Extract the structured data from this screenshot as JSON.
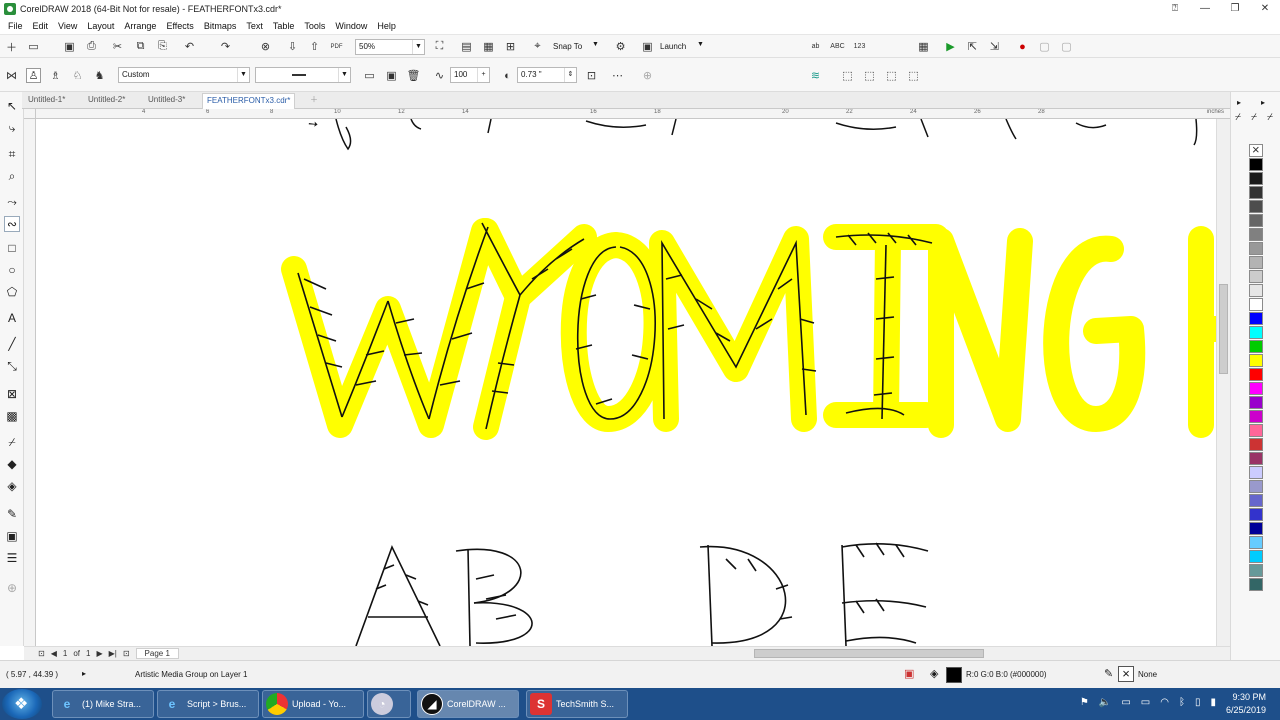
{
  "window": {
    "title": "CorelDRAW 2018 (64-Bit Not for resale) - FEATHERFONTx3.cdr*"
  },
  "menu": [
    "File",
    "Edit",
    "View",
    "Layout",
    "Arrange",
    "Effects",
    "Bitmaps",
    "Text",
    "Table",
    "Tools",
    "Window",
    "Help"
  ],
  "toolbar": {
    "zoom": "50%",
    "snap_to": "Snap To",
    "launch": "Launch",
    "pdf_label": "PDF"
  },
  "propbar": {
    "preset": "Custom",
    "smoothing": "100",
    "stroke_width": "0.73 \""
  },
  "doc_tabs": [
    "Untitled-1*",
    "Untitled-2*",
    "Untitled-3*",
    "FEATHERFONTx3.cdr*"
  ],
  "ruler": {
    "units": "inches",
    "h_numbers": [
      "4",
      "6",
      "8",
      "10",
      "12",
      "14",
      "16",
      "18",
      "20",
      "22",
      "24",
      "26",
      "28"
    ]
  },
  "canvas": {
    "word_row1": "WYOMING",
    "word_row2_left": "AB",
    "word_row2_right": "DE",
    "highlight_color": "#ffff00",
    "ink_color": "#111111"
  },
  "page_nav": {
    "current": "1",
    "of_label": "of",
    "total": "1",
    "page_tab": "Page 1"
  },
  "palette": [
    "#000000",
    "#1a1a1a",
    "#333333",
    "#4d4d4d",
    "#666666",
    "#808080",
    "#999999",
    "#b3b3b3",
    "#cccccc",
    "#e6e6e6",
    "#ffffff",
    "#0000ff",
    "#00ffff",
    "#00cc00",
    "#ffff00",
    "#ff0000",
    "#ff00ff",
    "#9900cc",
    "#cc00cc",
    "#ff6699",
    "#cc3333",
    "#993366",
    "#ccccff",
    "#9999cc",
    "#6666cc",
    "#3333cc",
    "#000099",
    "#66ccff",
    "#00ccff",
    "#669999",
    "#336666"
  ],
  "status": {
    "coords": "( 5.97 , 44.39 )",
    "info": "Artistic Media Group on Layer 1",
    "fill": "R:0 G:0 B:0 (#000000)",
    "outline": "None"
  },
  "taskbar": {
    "items": [
      "(1) Mike Stra...",
      "Script > Brus...",
      "Upload - Yo...",
      "",
      "CorelDRAW ...",
      "TechSmith S..."
    ],
    "time": "9:30 PM",
    "date": "6/25/2019"
  }
}
